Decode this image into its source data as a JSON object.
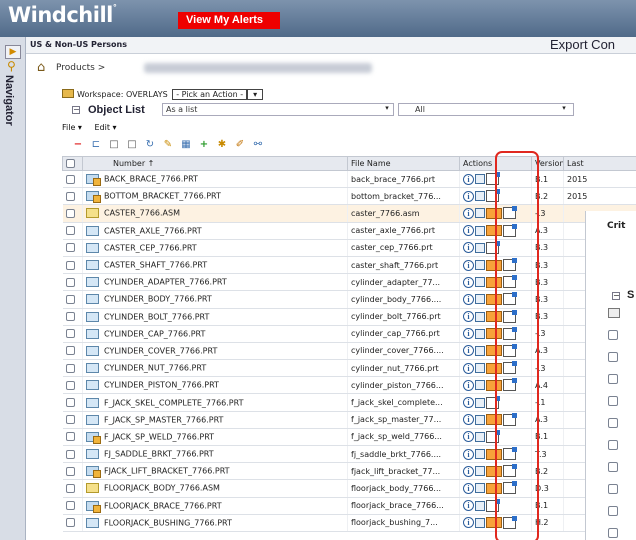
{
  "header": {
    "brand": "Windchill",
    "alerts_label": "View My Alerts",
    "context_title": "US & Non-US Persons",
    "export_label": "Export Con"
  },
  "breadcrumb": {
    "products": "Products >"
  },
  "rail": {
    "nav_label": "Navigator"
  },
  "workspace": {
    "prefix": "Workspace: OVERLAYS",
    "action_select": "- Pick an Action -"
  },
  "object_list": {
    "title": "Object List",
    "view_value": "As a list",
    "filter_value": "All"
  },
  "menus": [
    "File ▾",
    "Edit ▾"
  ],
  "table": {
    "columns": {
      "number": "Number ↑",
      "file_name": "File Name",
      "actions": "Actions",
      "version": "Version",
      "last": "Last"
    },
    "rows": [
      {
        "number": "BACK_BRACE_7766.PRT",
        "file": "back_brace_7766.prt",
        "version": "B.1",
        "last": "2015",
        "type": "prt",
        "modify": false
      },
      {
        "number": "BOTTOM_BRACKET_7766.PRT",
        "file": "bottom_bracket_776...",
        "version": "B.2",
        "last": "2015",
        "type": "prt",
        "modify": false
      },
      {
        "number": "CASTER_7766.ASM",
        "file": "caster_7766.asm",
        "version": "-.3",
        "last": "",
        "type": "asm",
        "modify": true,
        "selected": true
      },
      {
        "number": "CASTER_AXLE_7766.PRT",
        "file": "caster_axle_7766.prt",
        "version": "A.3",
        "last": "",
        "type": "part",
        "modify": true
      },
      {
        "number": "CASTER_CEP_7766.PRT",
        "file": "caster_cep_7766.prt",
        "version": "B.3",
        "last": "",
        "type": "part",
        "modify": false
      },
      {
        "number": "CASTER_SHAFT_7766.PRT",
        "file": "caster_shaft_7766.prt",
        "version": "B.3",
        "last": "",
        "type": "part",
        "modify": true
      },
      {
        "number": "CYLINDER_ADAPTER_7766.PRT",
        "file": "cylinder_adapter_77...",
        "version": "B.3",
        "last": "",
        "type": "part",
        "modify": true
      },
      {
        "number": "CYLINDER_BODY_7766.PRT",
        "file": "cylinder_body_7766....",
        "version": "B.3",
        "last": "",
        "type": "part",
        "modify": true
      },
      {
        "number": "CYLINDER_BOLT_7766.PRT",
        "file": "cylinder_bolt_7766.prt",
        "version": "B.3",
        "last": "",
        "type": "part",
        "modify": true
      },
      {
        "number": "CYLINDER_CAP_7766.PRT",
        "file": "cylinder_cap_7766.prt",
        "version": "-.3",
        "last": "",
        "type": "part",
        "modify": true
      },
      {
        "number": "CYLINDER_COVER_7766.PRT",
        "file": "cylinder_cover_7766....",
        "version": "A.3",
        "last": "",
        "type": "part",
        "modify": true
      },
      {
        "number": "CYLINDER_NUT_7766.PRT",
        "file": "cylinder_nut_7766.prt",
        "version": "-.3",
        "last": "",
        "type": "part",
        "modify": true
      },
      {
        "number": "CYLINDER_PISTON_7766.PRT",
        "file": "cylinder_piston_7766...",
        "version": "A.4",
        "last": "",
        "type": "part",
        "modify": true
      },
      {
        "number": "F_JACK_SKEL_COMPLETE_7766.PRT",
        "file": "f_jack_skel_complete...",
        "version": "-.1",
        "last": "",
        "type": "part",
        "modify": false
      },
      {
        "number": "F_JACK_SP_MASTER_7766.PRT",
        "file": "f_jack_sp_master_77...",
        "version": "A.3",
        "last": "",
        "type": "part",
        "modify": true
      },
      {
        "number": "F_JACK_SP_WELD_7766.PRT",
        "file": "f_jack_sp_weld_7766...",
        "version": "B.1",
        "last": "",
        "type": "prt",
        "modify": false
      },
      {
        "number": "FJ_SADDLE_BRKT_7766.PRT",
        "file": "fj_saddle_brkt_7766....",
        "version": "T.3",
        "last": "",
        "type": "part",
        "modify": true
      },
      {
        "number": "FJACK_LIFT_BRACKET_7766.PRT",
        "file": "fjack_lift_bracket_77...",
        "version": "B.2",
        "last": "",
        "type": "prt",
        "modify": true
      },
      {
        "number": "FLOORJACK_BODY_7766.ASM",
        "file": "floorjack_body_7766...",
        "version": "D.3",
        "last": "",
        "type": "asm",
        "modify": true
      },
      {
        "number": "FLOORJACK_BRACE_7766.PRT",
        "file": "floorjack_brace_7766...",
        "version": "B.1",
        "last": "",
        "type": "prt",
        "modify": false
      },
      {
        "number": "FLOORJACK_BUSHING_7766.PRT",
        "file": "floorjack_bushing_7...",
        "version": "H.2",
        "last": "",
        "type": "part",
        "modify": true
      }
    ]
  },
  "side_panel": {
    "criteria_label": "Crit",
    "section_label": "S"
  },
  "colors": {
    "header": "#506a89",
    "alert": "#ee0000",
    "highlight_box": "#e0281f",
    "selected_row": "#fdf2e2"
  }
}
